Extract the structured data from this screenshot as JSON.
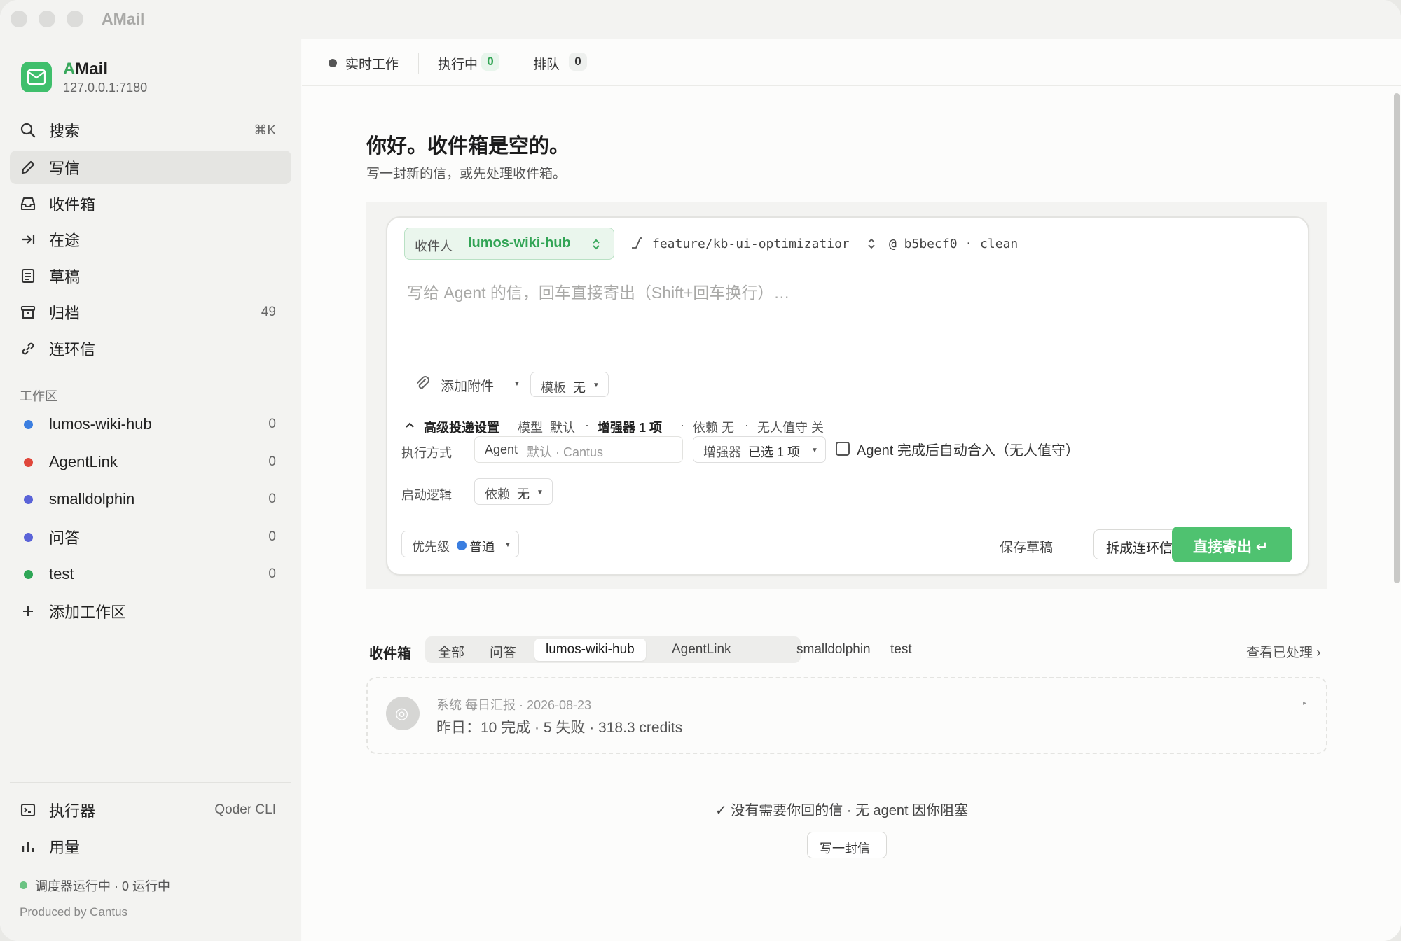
{
  "window": {
    "title": "AMail"
  },
  "app": {
    "name_accent": "A",
    "name_rest": "Mail",
    "address": "127.0.0.1:7180"
  },
  "nav": {
    "search": {
      "label": "搜索",
      "shortcut": "⌘K"
    },
    "compose": {
      "label": "写信"
    },
    "inbox": {
      "label": "收件箱"
    },
    "transit": {
      "label": "在途"
    },
    "drafts": {
      "label": "草稿"
    },
    "archive": {
      "label": "归档",
      "count": "49"
    },
    "chain": {
      "label": "连环信"
    }
  },
  "workspaces": {
    "section_label": "工作区",
    "items": [
      {
        "label": "lumos-wiki-hub",
        "count": "0",
        "color": "#3b7ee0"
      },
      {
        "label": "AgentLink",
        "count": "0",
        "color": "#e0473b"
      },
      {
        "label": "smalldolphin",
        "count": "0",
        "color": "#5a63d8"
      },
      {
        "label": "问答",
        "count": "0",
        "color": "#5a63d8"
      },
      {
        "label": "test",
        "count": "0",
        "color": "#2ea656"
      }
    ],
    "add_label": "添加工作区"
  },
  "sidebar_bottom": {
    "executor": {
      "label": "执行器",
      "value": "Qoder CLI"
    },
    "usage": {
      "label": "用量"
    },
    "status": "调度器运行中 · 0 运行中",
    "produced": "Produced by Cantus"
  },
  "topbar": {
    "live": "实时工作",
    "running": {
      "label": "执行中",
      "count": "0"
    },
    "queued": {
      "label": "排队",
      "count": "0"
    }
  },
  "greeting": {
    "title": "你好。收件箱是空的。",
    "subtitle": "写一封新的信，或先处理收件箱。"
  },
  "compose": {
    "recipient_label": "收件人",
    "recipient_value": "lumos-wiki-hub",
    "branch": "feature/kb-ui-optimizatior",
    "commit": "@ b5becf0 · clean",
    "placeholder": "写给 Agent 的信，回车直接寄出（Shift+回车换行）…",
    "attach": "添加附件",
    "template_label": "模板",
    "template_value": "无",
    "advanced": {
      "title": "高级投递设置",
      "model_label": "模型",
      "model_value": "默认",
      "enhancer": "增强器 1 项",
      "dependency": "依赖 无",
      "unattended": "无人值守 关"
    },
    "exec_label": "执行方式",
    "agent_text": "Agent",
    "agent_default": "默认 · Cantus",
    "enhancer_label": "增强器",
    "enhancer_value": "已选 1 项",
    "auto_merge": "Agent 完成后自动合入（无人值守）",
    "start_label": "启动逻辑",
    "dep_label": "依赖",
    "dep_value": "无",
    "priority_label": "优先级",
    "priority_value": "普通",
    "save_draft": "保存草稿",
    "split_chain": "拆成连环信",
    "send": "直接寄出 ↵"
  },
  "inbox": {
    "label": "收件箱",
    "filters": [
      "全部",
      "问答",
      "lumos-wiki-hub",
      "AgentLink",
      "smalldolphin",
      "test"
    ],
    "active_filter": "lumos-wiki-hub",
    "view_done": "查看已处理 ›",
    "mail": {
      "avatar": "◎",
      "meta": "系统  每日汇报 · 2026-08-23",
      "body": "昨日：10 完成 · 5 失败 · 318.3 credits"
    }
  },
  "empty": {
    "message": "✓ 没有需要你回的信 · 无 agent 因你阻塞",
    "write_button": "写一封信"
  }
}
